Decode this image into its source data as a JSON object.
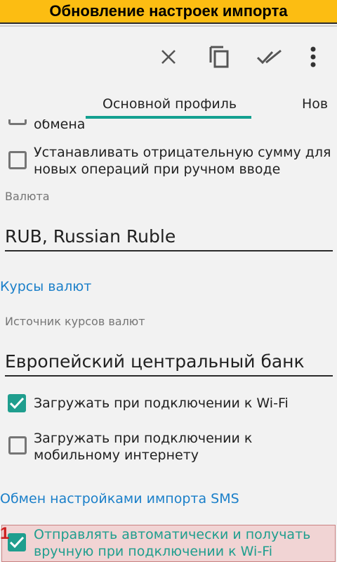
{
  "banner": {
    "title": "Обновление настроек импорта",
    "color": "#fcbd12"
  },
  "toolbar": {
    "icons": [
      "close-icon",
      "copy-icon",
      "done-all-icon",
      "more-vert-icon"
    ]
  },
  "tabs": {
    "items": [
      {
        "label": "Основной профиль",
        "selected": true
      },
      {
        "label": "Нов",
        "selected": false
      }
    ],
    "indicator_color": "#13a090"
  },
  "settings": {
    "partial_item": {
      "label": "обмена"
    },
    "negative_sum": {
      "label": "Устанавливать отрицательную сумму для новых операций при ручном вводе",
      "checked": false
    },
    "currency": {
      "hint": "Валюта",
      "value": "RUB, Russian Ruble"
    },
    "rates_link": "Курсы валют",
    "rates_source": {
      "hint": "Источник курсов валют",
      "value": "Европейский центральный банк"
    },
    "wifi_download": {
      "label": "Загружать при подключении к Wi-Fi",
      "checked": true
    },
    "mobile_download": {
      "label": "Загружать при подключении к мобильному интернету",
      "checked": false
    },
    "sms_link": "Обмен настройками импорта SMS",
    "auto_send": {
      "label": "Отправлять автоматически и получать вручную при подключении к Wi-Fi",
      "checked": true
    }
  },
  "annotation": {
    "number": "1",
    "color": "#cc1f1f"
  },
  "colors": {
    "accent": "#1f9e8e",
    "link": "#1a7fc9"
  }
}
